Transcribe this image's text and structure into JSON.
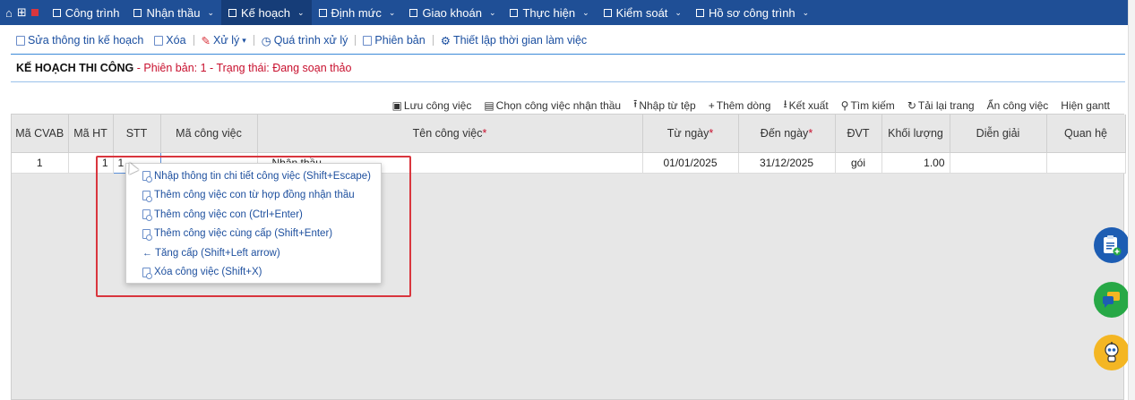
{
  "nav": {
    "items": [
      {
        "label": "Công trình",
        "icon": "list-icon",
        "chevron": false
      },
      {
        "label": "Nhận thầu",
        "icon": "book-icon",
        "chevron": true
      },
      {
        "label": "Kế hoạch",
        "icon": "calendar-icon",
        "chevron": true,
        "active": true
      },
      {
        "label": "Định mức",
        "icon": "doc-icon",
        "chevron": true
      },
      {
        "label": "Giao khoán",
        "icon": "doc-icon",
        "chevron": true
      },
      {
        "label": "Thực hiện",
        "icon": "check-icon",
        "chevron": true
      },
      {
        "label": "Kiểm soát",
        "icon": "monitor-icon",
        "chevron": true
      },
      {
        "label": "Hồ sơ công trình",
        "icon": "folder-icon",
        "chevron": true
      }
    ]
  },
  "toolbar": {
    "edit": "Sửa thông tin kế hoạch",
    "delete": "Xóa",
    "process": "Xử lý",
    "history": "Quá trình xử lý",
    "version": "Phiên bản",
    "worktime": "Thiết lập thời gian làm việc"
  },
  "heading": {
    "title": "KẾ HOẠCH THI CÔNG",
    "subtitle": " - Phiên bản: 1 - Trạng thái: Đang soạn thảo"
  },
  "gridbar": {
    "save": "Lưu công việc",
    "choose": "Chọn công việc nhận thầu",
    "import": "Nhập từ tệp",
    "add": "Thêm dòng",
    "export": "Kết xuất",
    "search": "Tìm kiếm",
    "reload": "Tải lại trang",
    "hide": "Ẩn công việc",
    "gantt": "Hiện gantt"
  },
  "table": {
    "headers": {
      "ma_cvab": "Mã CVAB",
      "ma_ht": "Mã HT",
      "stt": "STT",
      "ma_cv": "Mã công việc",
      "ten_cv": "Tên công việc",
      "tu_ngay": "Từ ngày",
      "den_ngay": "Đến ngày",
      "dvt": "ĐVT",
      "khoi_luong": "Khối lượng",
      "dien_giai": "Diễn giải",
      "quan_he": "Quan hệ",
      "required_mark": "*"
    },
    "row": {
      "ma_cvab": "1",
      "ma_ht": "1",
      "stt": "1",
      "ma_cv": "",
      "ten_cv": "Nhận thầu",
      "tu_ngay": "01/01/2025",
      "den_ngay": "31/12/2025",
      "dvt": "gói",
      "khoi_luong": "1.00",
      "dien_giai": "",
      "quan_he": ""
    }
  },
  "context_menu": {
    "items": [
      "Nhập thông tin chi tiết công việc (Shift+Escape)",
      "Thêm công việc con từ hợp đồng nhận thầu",
      "Thêm công việc con (Ctrl+Enter)",
      "Thêm công việc cùng cấp (Shift+Enter)",
      "Tăng cấp (Shift+Left arrow)",
      "Xóa công việc (Shift+X)"
    ]
  },
  "colors": {
    "nav_bg": "#1f4f96",
    "link": "#1b4fa0",
    "required": "#c8102e",
    "highlight": "#d9363e"
  }
}
